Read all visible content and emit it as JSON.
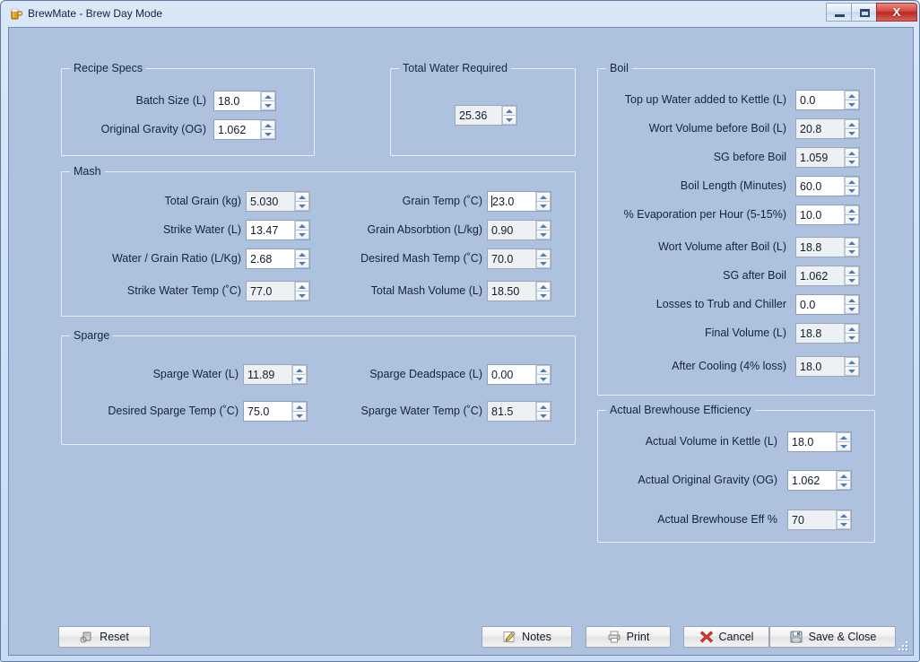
{
  "window": {
    "title": "BrewMate - Brew Day Mode",
    "app_icon": "beer-mug-icon",
    "minimize_label": "Minimize",
    "maximize_label": "Maximize",
    "close_label": "X"
  },
  "groups": {
    "recipe_specs": {
      "title": "Recipe Specs",
      "fields": [
        {
          "label": "Batch Size (L)",
          "value": "18.0",
          "readonly": false
        },
        {
          "label": "Original Gravity (OG)",
          "value": "1.062",
          "readonly": false
        }
      ]
    },
    "total_water": {
      "title": "Total Water Required",
      "fields": [
        {
          "label": "",
          "value": "25.36",
          "readonly": true
        }
      ]
    },
    "mash": {
      "title": "Mash",
      "left_fields": [
        {
          "label": "Total Grain (kg)",
          "value": "5.030",
          "readonly": true
        },
        {
          "label": "Strike Water (L)",
          "value": "13.47",
          "readonly": false
        },
        {
          "label": "Water / Grain Ratio (L/Kg)",
          "value": "2.68",
          "readonly": false
        },
        {
          "label": "Strike Water Temp (˚C)",
          "value": "77.0",
          "readonly": true
        }
      ],
      "right_fields": [
        {
          "label": "Grain Temp (˚C)",
          "value": "23.0",
          "readonly": false,
          "focused": true
        },
        {
          "label": "Grain Absorbtion (L/kg)",
          "value": "0.90",
          "readonly": true
        },
        {
          "label": "Desired Mash Temp (˚C)",
          "value": "70.0",
          "readonly": true
        },
        {
          "label": "Total Mash Volume (L)",
          "value": "18.50",
          "readonly": true
        }
      ]
    },
    "sparge": {
      "title": "Sparge",
      "left_fields": [
        {
          "label": "Sparge Water (L)",
          "value": "11.89",
          "readonly": true
        },
        {
          "label": "Desired Sparge Temp (˚C)",
          "value": "75.0",
          "readonly": false
        }
      ],
      "right_fields": [
        {
          "label": "Sparge Deadspace (L)",
          "value": "0.00",
          "readonly": false
        },
        {
          "label": "Sparge Water Temp (˚C)",
          "value": "81.5",
          "readonly": true
        }
      ]
    },
    "boil": {
      "title": "Boil",
      "fields": [
        {
          "label": "Top up Water added to Kettle (L)",
          "value": "0.0",
          "readonly": false
        },
        {
          "label": "Wort Volume before Boil (L)",
          "value": "20.8",
          "readonly": true
        },
        {
          "label": "SG before Boil",
          "value": "1.059",
          "readonly": true
        },
        {
          "label": "Boil Length (Minutes)",
          "value": "60.0",
          "readonly": false
        },
        {
          "label": "% Evaporation per Hour (5-15%)",
          "value": "10.0",
          "readonly": false
        },
        {
          "label": "Wort Volume after Boil (L)",
          "value": "18.8",
          "readonly": true
        },
        {
          "label": "SG after Boil",
          "value": "1.062",
          "readonly": true
        },
        {
          "label": "Losses to Trub and Chiller",
          "value": "0.0",
          "readonly": false
        },
        {
          "label": "Final Volume (L)",
          "value": "18.8",
          "readonly": true
        },
        {
          "label": "After Cooling (4% loss)",
          "value": "18.0",
          "readonly": true
        }
      ]
    },
    "actual_efficiency": {
      "title": "Actual Brewhouse Efficiency",
      "fields": [
        {
          "label": "Actual Volume in Kettle (L)",
          "value": "18.0",
          "readonly": false
        },
        {
          "label": "Actual Original Gravity (OG)",
          "value": "1.062",
          "readonly": false
        },
        {
          "label": "Actual Brewhouse Eff %",
          "value": "70",
          "readonly": true
        }
      ]
    }
  },
  "buttons": {
    "reset": {
      "label": "Reset",
      "icon": "reset-icon"
    },
    "notes": {
      "label": "Notes",
      "icon": "pencil-icon"
    },
    "print": {
      "label": "Print",
      "icon": "printer-icon"
    },
    "cancel": {
      "label": "Cancel",
      "icon": "red-x-icon"
    },
    "save_close": {
      "label": "Save & Close",
      "icon": "floppy-disk-icon"
    }
  },
  "colors": {
    "client_background": "#aec2df",
    "titlebar": "#cfe0f4",
    "close_button": "#c23c32",
    "field_readonly": "#eef1f4",
    "field_editable": "#ffffff",
    "spinner_arrow": "#4e7ab5"
  }
}
